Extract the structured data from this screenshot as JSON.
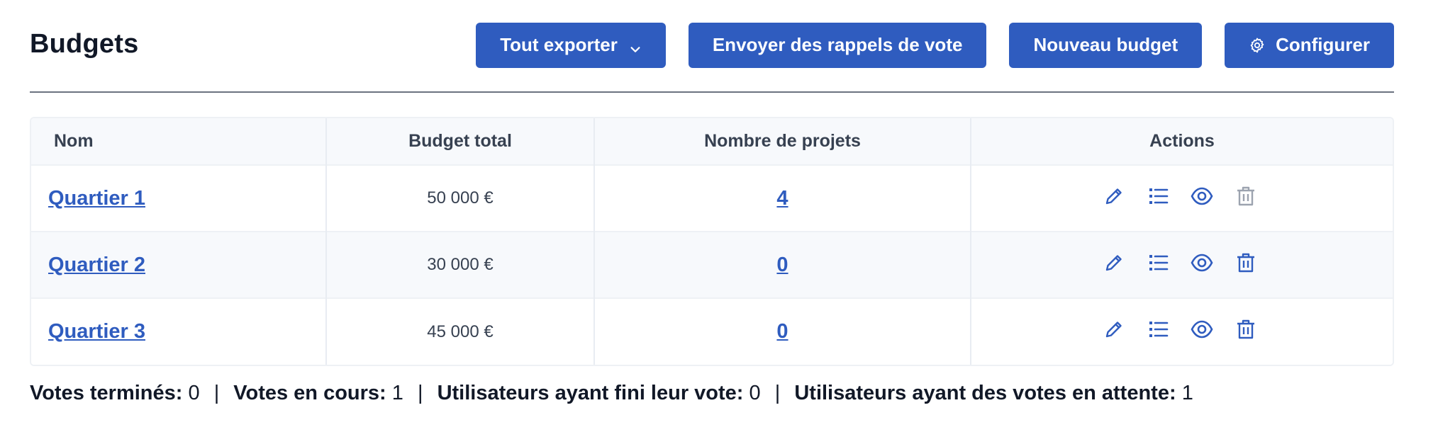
{
  "header": {
    "title": "Budgets",
    "buttons": {
      "export": "Tout exporter",
      "reminders": "Envoyer des rappels de vote",
      "new_budget": "Nouveau budget",
      "configure": "Configurer"
    }
  },
  "table": {
    "columns": {
      "name": "Nom",
      "total": "Budget total",
      "projects": "Nombre de projets",
      "actions": "Actions"
    },
    "rows": [
      {
        "name": "Quartier 1",
        "total": "50 000 €",
        "projects": "4",
        "delete_enabled": false
      },
      {
        "name": "Quartier 2",
        "total": "30 000 €",
        "projects": "0",
        "delete_enabled": true
      },
      {
        "name": "Quartier 3",
        "total": "45 000 €",
        "projects": "0",
        "delete_enabled": true
      }
    ],
    "action_icons": [
      "edit-icon",
      "list-icon",
      "eye-icon",
      "trash-icon"
    ]
  },
  "stats": {
    "finished_label": "Votes terminés:",
    "finished_value": "0",
    "ongoing_label": "Votes en cours:",
    "ongoing_value": "1",
    "users_done_label": "Utilisateurs ayant fini leur vote:",
    "users_done_value": "0",
    "users_pending_label": "Utilisateurs ayant des votes en attente:",
    "users_pending_value": "1",
    "separator": "|"
  },
  "colors": {
    "primary": "#2f5cbf",
    "disabled_icon": "#9ca3af",
    "text": "#111827"
  }
}
